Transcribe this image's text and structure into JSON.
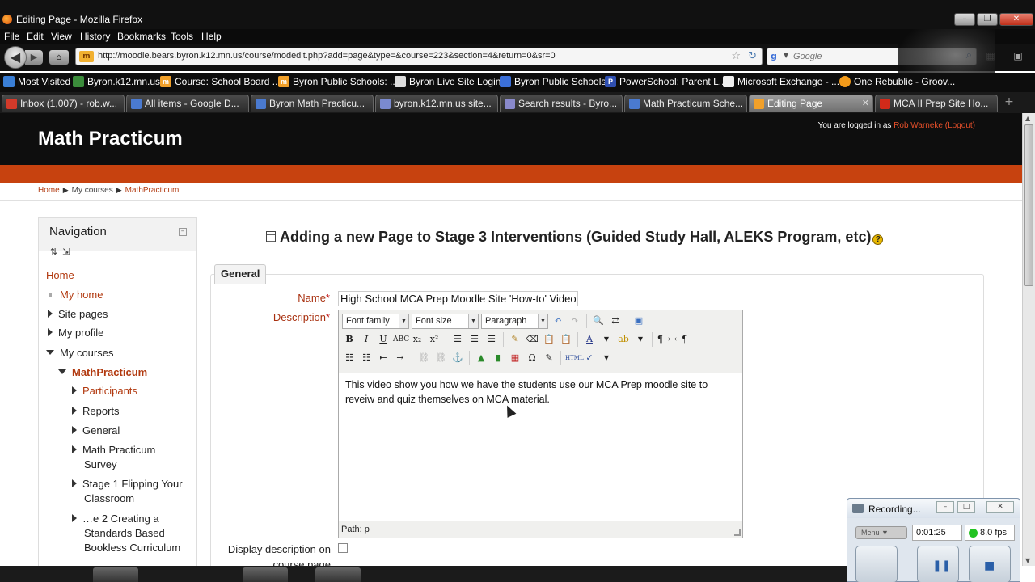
{
  "window": {
    "title": "Editing Page - Mozilla Firefox"
  },
  "menubar": [
    "File",
    "Edit",
    "View",
    "History",
    "Bookmarks",
    "Tools",
    "Help"
  ],
  "navbar": {
    "url": "http://moodle.bears.byron.k12.mn.us/course/modedit.php?add=page&type=&course=223&section=4&return=0&sr=0",
    "search_placeholder": "Google"
  },
  "bookmarks": [
    {
      "label": "Most Visited",
      "color": "#3a7fd6"
    },
    {
      "label": "Byron.k12.mn.us",
      "color": "#3b8c3b"
    },
    {
      "label": "Course: School Board ...",
      "color": "#f1a02a"
    },
    {
      "label": "Byron Public Schools: ...",
      "color": "#f1a02a"
    },
    {
      "label": "Byron Live Site Login",
      "color": "#dddddd"
    },
    {
      "label": "Byron Public Schools",
      "color": "#3b6fd8"
    },
    {
      "label": "PowerSchool: Parent L...",
      "color": "#2f4fb0"
    },
    {
      "label": "Microsoft Exchange - ...",
      "color": "#eeeeee"
    },
    {
      "label": "One Rebublic - Groov...",
      "color": "#f29a1a"
    }
  ],
  "tabs": [
    {
      "label": "Inbox (1,007) - rob.w...",
      "color": "#d23a2a"
    },
    {
      "label": "All items - Google D...",
      "color": "#4a7ad0"
    },
    {
      "label": "Byron Math Practicu...",
      "color": "#4a7ad0"
    },
    {
      "label": "byron.k12.mn.us site...",
      "color": "#7a8ad0"
    },
    {
      "label": "Search results - Byro...",
      "color": "#8a8acc"
    },
    {
      "label": "Math Practicum Sche...",
      "color": "#4a7ad0"
    },
    {
      "label": "Editing Page",
      "color": "#f1a02a",
      "active": true
    },
    {
      "label": "MCA II Prep Site Ho...",
      "color": "#d22a1a"
    }
  ],
  "site": {
    "title": "Math Practicum",
    "login_prefix": "You are logged in as",
    "user": "Rob Warneke",
    "logout": "(Logout)"
  },
  "breadcrumb": [
    "Home",
    "My courses",
    "MathPracticum"
  ],
  "navigation": {
    "title": "Navigation",
    "items": [
      {
        "label": "Home"
      },
      {
        "label": "My home"
      },
      {
        "label": "Site pages"
      },
      {
        "label": "My profile"
      },
      {
        "label": "My courses"
      },
      {
        "label": "MathPracticum"
      },
      {
        "label": "Participants"
      },
      {
        "label": "Reports"
      },
      {
        "label": "General"
      },
      {
        "label": "Math Practicum",
        "label2": "Survey"
      },
      {
        "label": "Stage 1 Flipping Your",
        "label2": "Classroom"
      },
      {
        "label": "…e 2 Creating a",
        "label2": "Standards Based",
        "label3": "Bookless Curriculum"
      }
    ]
  },
  "main": {
    "heading": "Adding a new Page to Stage 3 Interventions (Guided Study Hall, ALEKS Program, etc)",
    "legend": "General",
    "name_label": "Name",
    "name_value": "High School MCA Prep Moodle Site 'How-to' Video",
    "description_label": "Description",
    "editor": {
      "font_family": "Font family",
      "font_size": "Font size",
      "format": "Paragraph",
      "content": "This video show you how we have the students use our MCA Prep moodle site to reveiw and quiz themselves on MCA material.",
      "path": "Path: p"
    },
    "display_desc_label": "Display description on",
    "display_desc_label2": "course page"
  },
  "recorder": {
    "title": "Recording...",
    "menu": "Menu",
    "time": "0:01:25",
    "fps": "8.0 fps"
  }
}
